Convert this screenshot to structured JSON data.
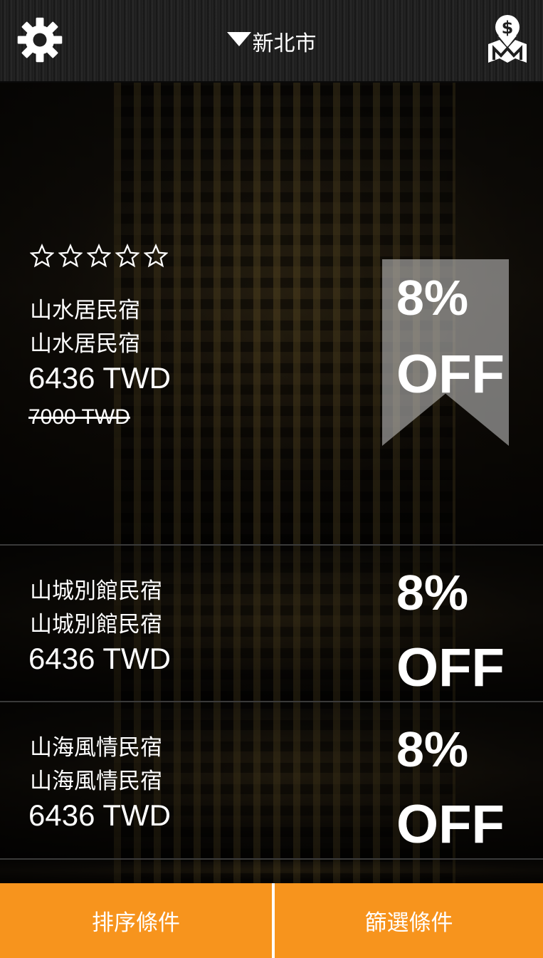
{
  "header": {
    "city": "新北市",
    "settings_icon": "gear-icon",
    "map_icon": "map-price-icon"
  },
  "hotels": [
    {
      "name_line1": "山水居民宿",
      "name_line2": "山水居民宿",
      "price": "6436 TWD",
      "original_price": "7000 TWD",
      "discount_pct": "8%",
      "discount_off": "OFF",
      "stars_filled": 0,
      "stars_total": 5
    },
    {
      "name_line1": "山城別館民宿",
      "name_line2": "山城別館民宿",
      "price": "6436 TWD",
      "discount_pct": "8%",
      "discount_off": "OFF"
    },
    {
      "name_line1": "山海風情民宿",
      "name_line2": "山海風情民宿",
      "price": "6436 TWD",
      "discount_pct": "8%",
      "discount_off": "OFF"
    }
  ],
  "bottom_bar": {
    "sort_label": "排序條件",
    "filter_label": "篩選條件"
  },
  "colors": {
    "accent": "#f7941d",
    "header_bg": "#1f1f1f"
  }
}
